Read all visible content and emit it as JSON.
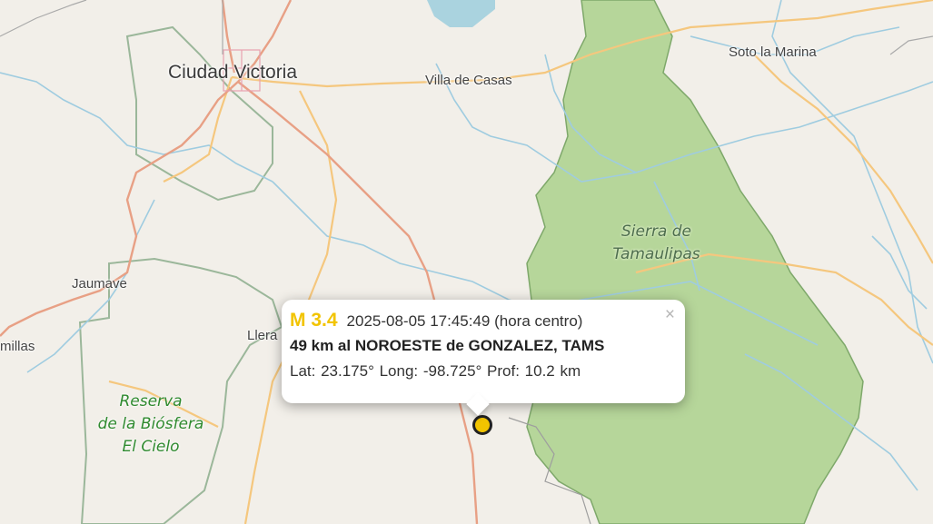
{
  "map": {
    "labels": {
      "ciudad_victoria": "Ciudad Victoria",
      "villa_de_casas": "Villa de Casas",
      "soto_la_marina": "Soto la Marina",
      "jaumave": "Jaumave",
      "llera": "Llera",
      "tula": "millas",
      "sierra": [
        "Sierra de",
        "Tamaulipas"
      ],
      "reserva": [
        "Reserva",
        "de la Biósfera",
        "El Cielo"
      ]
    },
    "colors": {
      "land": "#f2efe9",
      "forest": "#b6d69a",
      "forest_border": "#7ea86a",
      "water": "#aad3df",
      "river": "#9fcce0",
      "major_road": "#e8a085",
      "minor_road": "#f5c77e",
      "boundary": "#9bb79a"
    }
  },
  "popup": {
    "magnitude": "M 3.4",
    "datetime": "2025-08-05  17:45:49 (hora centro)",
    "location": "49 km al NOROESTE de GONZALEZ, TAMS",
    "coordinates": "Lat: 23.175°  Long: -98.725°  Prof: 10.2 km",
    "close": "×"
  },
  "marker": {
    "color": "#f2c400"
  }
}
